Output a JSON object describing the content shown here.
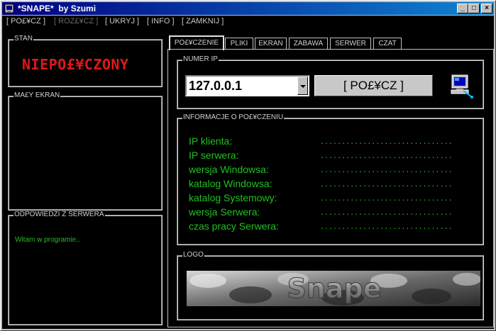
{
  "window": {
    "title": "*SNAPE*  by Szumi",
    "min_glyph": "_",
    "max_glyph": "□",
    "close_glyph": "×"
  },
  "menu": [
    {
      "label": "[ PO£¥CZ ]",
      "disabled": false
    },
    {
      "label": "[ ROZ£¥CZ ]",
      "disabled": true
    },
    {
      "label": "[ UKRYJ ]",
      "disabled": false
    },
    {
      "label": "[ INFO ]",
      "disabled": false
    },
    {
      "label": "[ ZAMKNIJ ]",
      "disabled": false
    }
  ],
  "left": {
    "stan_label": "STAN",
    "status": "NIEPO£¥CZONY",
    "maly_ekran_label": "MA£Y EKRAN",
    "odpowiedzi_label": "ODPOWIEDZI Z SERWERA",
    "server_message": "Witam w programie.."
  },
  "tabs": [
    "PO£¥CZENIE",
    "PLIKI",
    "EKRAN",
    "ZABAWA",
    "SERWER",
    "CZAT"
  ],
  "connection": {
    "numer_ip_label": "NUMER IP",
    "ip_value": "127.0.0.1",
    "connect_label": "[ PO£¥CZ ]",
    "info_group_label": "INFORMACJE O PO£¥CZENIU",
    "info_rows": [
      {
        "label": "IP klienta:",
        "value": "..............................."
      },
      {
        "label": "IP serwera:",
        "value": "..............................."
      },
      {
        "label": "wersja Windowsa:",
        "value": "..............................."
      },
      {
        "label": "katalog Windowsa:",
        "value": "..............................."
      },
      {
        "label": "katalog Systemowy:",
        "value": "..............................."
      },
      {
        "label": "wersja Serwera:",
        "value": "..............................."
      },
      {
        "label": "czas pracy Serwera:",
        "value": "..............................."
      }
    ],
    "logo_label": "LOGO",
    "logo_text": "Snape"
  },
  "colors": {
    "title_gradient_start": "#000080",
    "title_gradient_end": "#1084d0",
    "status_red": "#e01818",
    "info_green": "#20c020"
  }
}
